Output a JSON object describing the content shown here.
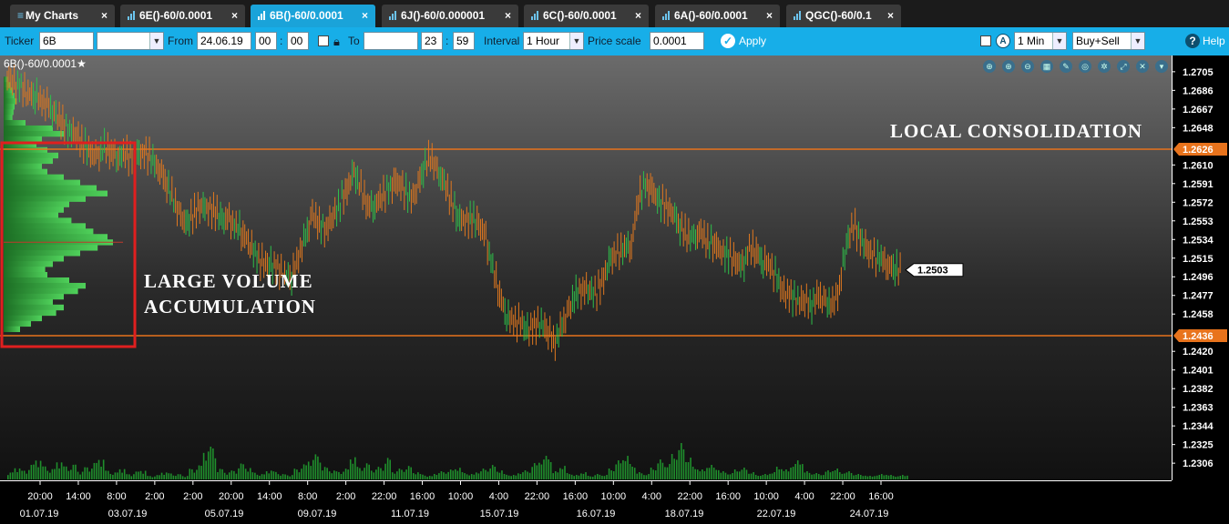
{
  "tabs": [
    {
      "label": "My Charts",
      "icon": "list-icon",
      "active": false
    },
    {
      "label": "6E()-60/0.0001",
      "icon": "bar-chart-icon",
      "active": false
    },
    {
      "label": "6B()-60/0.0001",
      "icon": "bar-chart-icon",
      "active": true
    },
    {
      "label": "6J()-60/0.000001",
      "icon": "bar-chart-icon",
      "active": false
    },
    {
      "label": "6C()-60/0.0001",
      "icon": "bar-chart-icon",
      "active": false
    },
    {
      "label": "6A()-60/0.0001",
      "icon": "bar-chart-icon",
      "active": false
    },
    {
      "label": "QGC()-60/0.1",
      "icon": "bar-chart-icon",
      "active": false
    }
  ],
  "toolbar": {
    "ticker_label": "Ticker",
    "ticker_value": "6B",
    "contract_value": "",
    "from_label": "From",
    "from_date": "24.06.19",
    "from_hour": "00",
    "from_sep": ":",
    "from_min": "00",
    "to_label": "To",
    "to_date": "",
    "to_hour": "23",
    "to_sep": ":",
    "to_min": "59",
    "interval_label": "Interval",
    "interval_value": "1 Hour",
    "price_scale_label": "Price scale",
    "price_scale_value": "0.0001",
    "apply_label": "Apply",
    "timeframe_value": "1 Min",
    "side_value": "Buy+Sell",
    "help_label": "Help"
  },
  "chart": {
    "symbol": "6B()-60/0.0001",
    "star": "★",
    "annotation_top": "LOCAL CONSOLIDATION",
    "annotation_box_line1": "LARGE VOLUME",
    "annotation_box_line2": "ACCUMULATION",
    "tools": [
      "zoom-fit-icon",
      "zoom-in-icon",
      "zoom-out-icon",
      "grid-icon",
      "pen-icon",
      "settings-wheel-icon",
      "gear-icon",
      "expand-icon",
      "close-icon",
      "chevron-down-icon"
    ]
  },
  "chart_data": {
    "type": "candlestick",
    "price_ticks": [
      "1.2705",
      "1.2686",
      "1.2667",
      "1.2648",
      "1.2610",
      "1.2591",
      "1.2572",
      "1.2553",
      "1.2534",
      "1.2515",
      "1.2496",
      "1.2477",
      "1.2458",
      "1.2420",
      "1.2401",
      "1.2382",
      "1.2363",
      "1.2344",
      "1.2325",
      "1.2306"
    ],
    "ylim": [
      1.2295,
      1.2716
    ],
    "levels": [
      {
        "price": "1.2626",
        "color": "#e8731c"
      },
      {
        "price": "1.2436",
        "color": "#e8731c"
      }
    ],
    "last_price": "1.2503",
    "time_ticks": [
      "20:00",
      "14:00",
      "8:00",
      "2:00",
      "2:00",
      "20:00",
      "14:00",
      "8:00",
      "2:00",
      "22:00",
      "16:00",
      "10:00",
      "4:00",
      "22:00",
      "16:00",
      "10:00",
      "4:00",
      "22:00",
      "16:00",
      "10:00",
      "4:00",
      "22:00",
      "16:00"
    ],
    "date_ticks": [
      "01.07.19",
      "03.07.19",
      "05.07.19",
      "09.07.19",
      "11.07.19",
      "15.07.19",
      "16.07.19",
      "18.07.19",
      "22.07.19",
      "24.07.19"
    ],
    "price_path": [
      1.27,
      1.2692,
      1.2689,
      1.2683,
      1.2681,
      1.2676,
      1.2668,
      1.266,
      1.2652,
      1.2645,
      1.264,
      1.2632,
      1.2622,
      1.2618,
      1.2627,
      1.2624,
      1.2619,
      1.2621,
      1.2617,
      1.262,
      1.2622,
      1.2614,
      1.2606,
      1.2591,
      1.2574,
      1.2556,
      1.255,
      1.2563,
      1.2568,
      1.2566,
      1.2562,
      1.2554,
      1.2553,
      1.2548,
      1.254,
      1.253,
      1.2515,
      1.2509,
      1.2508,
      1.2504,
      1.2498,
      1.2496,
      1.2518,
      1.2535,
      1.256,
      1.2548,
      1.2546,
      1.2558,
      1.2572,
      1.2585,
      1.2602,
      1.2585,
      1.2568,
      1.257,
      1.2577,
      1.2585,
      1.2592,
      1.2588,
      1.2575,
      1.2585,
      1.2607,
      1.2618,
      1.2603,
      1.2591,
      1.2575,
      1.2556,
      1.2554,
      1.2555,
      1.255,
      1.2534,
      1.2505,
      1.2478,
      1.2457,
      1.245,
      1.2449,
      1.2441,
      1.2446,
      1.245,
      1.244,
      1.243,
      1.2445,
      1.2462,
      1.2478,
      1.2485,
      1.2482,
      1.248,
      1.2495,
      1.2514,
      1.252,
      1.2525,
      1.253,
      1.2575,
      1.259,
      1.2583,
      1.2573,
      1.2567,
      1.2562,
      1.2548,
      1.2538,
      1.2535,
      1.254,
      1.2532,
      1.253,
      1.2522,
      1.2518,
      1.2512,
      1.2505,
      1.2525,
      1.2522,
      1.2512,
      1.2507,
      1.2493,
      1.2479,
      1.2477,
      1.2472,
      1.2472,
      1.2468,
      1.2476,
      1.247,
      1.2466,
      1.2487,
      1.253,
      1.255,
      1.2535,
      1.2523,
      1.2516,
      1.2514,
      1.2509,
      1.2504,
      1.2503
    ],
    "volume_path": [
      8,
      13,
      10,
      17,
      22,
      15,
      12,
      20,
      15,
      17,
      9,
      14,
      19,
      23,
      10,
      8,
      12,
      6,
      9,
      10,
      4,
      5,
      8,
      7,
      6,
      4,
      12,
      16,
      32,
      37,
      12,
      8,
      10,
      18,
      13,
      8,
      6,
      10,
      9,
      6,
      5,
      12,
      17,
      22,
      28,
      14,
      10,
      9,
      12,
      25,
      14,
      18,
      11,
      14,
      24,
      9,
      12,
      15,
      8,
      6,
      4,
      7,
      9,
      11,
      13,
      8,
      6,
      9,
      12,
      16,
      10,
      6,
      5,
      8,
      10,
      18,
      22,
      26,
      9,
      15,
      7,
      5,
      8,
      4,
      6,
      5,
      12,
      21,
      26,
      17,
      8,
      6,
      13,
      22,
      17,
      28,
      40,
      24,
      14,
      11,
      16,
      13,
      9,
      7,
      11,
      13,
      8,
      5,
      6,
      8,
      14,
      11,
      17,
      21,
      9,
      7,
      6,
      10,
      12,
      8,
      9,
      6,
      5,
      4,
      5,
      6,
      5,
      4,
      5
    ],
    "volume_profile": [
      0.04,
      0.06,
      0.08,
      0.1,
      0.12,
      0.1,
      0.09,
      0.08,
      0.2,
      0.45,
      0.55,
      0.35,
      0.3,
      0.4,
      0.5,
      0.45,
      0.35,
      0.4,
      0.55,
      0.7,
      0.85,
      0.95,
      0.75,
      0.6,
      0.55,
      0.5,
      0.62,
      0.75,
      0.82,
      0.95,
      1.0,
      0.86,
      0.7,
      0.55,
      0.45,
      0.38,
      0.4,
      0.6,
      0.75,
      0.68,
      0.55,
      0.45,
      0.55,
      0.48,
      0.35,
      0.25,
      0.15
    ],
    "grid": false
  }
}
